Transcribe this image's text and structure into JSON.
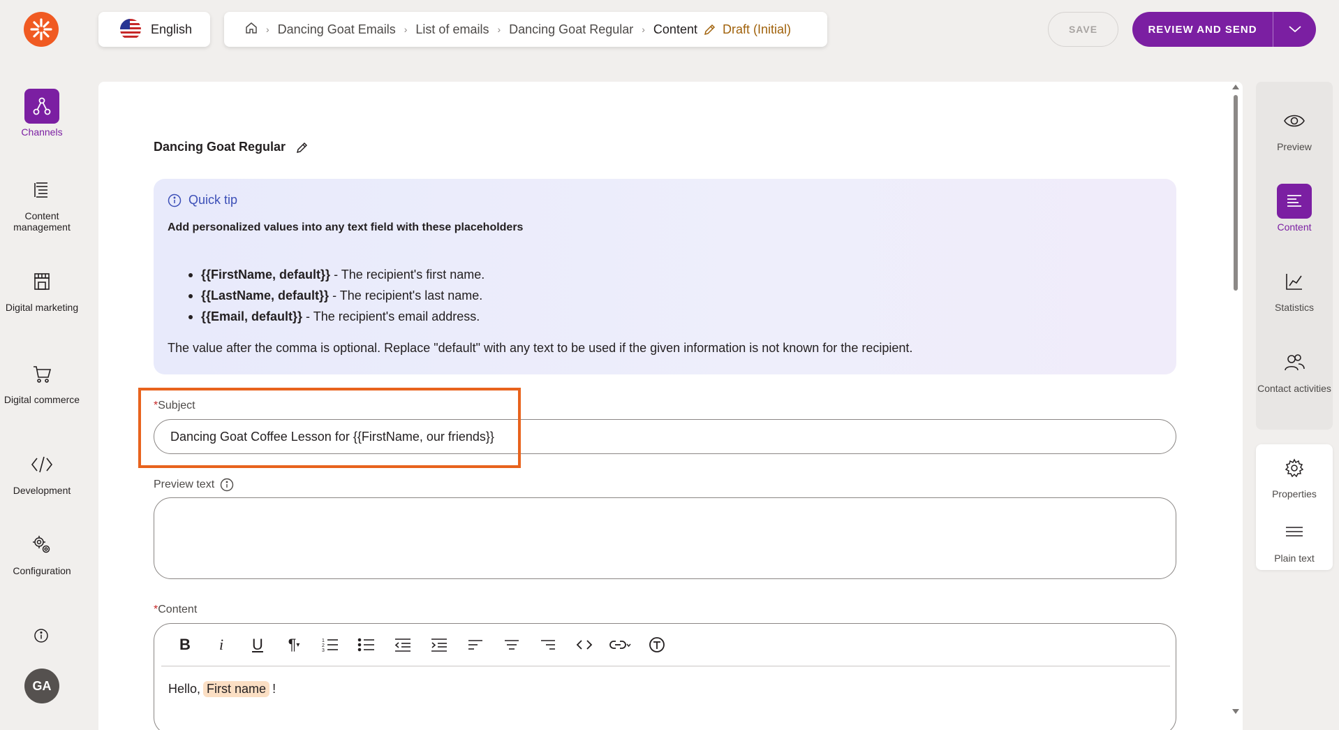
{
  "app": {
    "logo_icon": "kentico-logo-icon",
    "brand_color": "#7b1fa2",
    "accent_color": "#f05a22"
  },
  "left_nav": {
    "items": [
      {
        "label": "Channels",
        "icon": "channels-icon",
        "active": true
      },
      {
        "label": "Content management",
        "icon": "content-management-icon",
        "active": false
      },
      {
        "label": "Digital marketing",
        "icon": "digital-marketing-icon",
        "active": false
      },
      {
        "label": "Digital commerce",
        "icon": "cart-icon",
        "active": false
      },
      {
        "label": "Development",
        "icon": "code-icon",
        "active": false
      },
      {
        "label": "Configuration",
        "icon": "gears-icon",
        "active": false
      }
    ],
    "avatar_initials": "GA"
  },
  "header": {
    "language": "English",
    "breadcrumb": [
      "Dancing Goat Emails",
      "List of emails",
      "Dancing Goat Regular",
      "Content"
    ],
    "status": "Draft (Initial)",
    "save_label": "SAVE",
    "review_label": "REVIEW AND SEND"
  },
  "main": {
    "email_title": "Dancing Goat Regular",
    "tip": {
      "heading": "Quick tip",
      "intro": "Add personalized values into any text field with these placeholders",
      "items": [
        {
          "token": "{{FirstName, default}}",
          "desc": " - The recipient's first name."
        },
        {
          "token": "{{LastName, default}}",
          "desc": " - The recipient's last name."
        },
        {
          "token": "{{Email, default}}",
          "desc": " - The recipient's email address."
        }
      ],
      "note": "The value after the comma is optional. Replace \"default\" with any text to be used if the given information is not known for the recipient."
    },
    "subject": {
      "label": "Subject",
      "value": "Dancing Goat Coffee Lesson for {{FirstName, our friends}}"
    },
    "preview_text": {
      "label": "Preview text",
      "value": ""
    },
    "content": {
      "label": "Content",
      "greeting": "Hello,",
      "placeholder_chip": "First name",
      "exclamation": "!"
    }
  },
  "right_nav": {
    "items": [
      {
        "label": "Preview",
        "icon": "eye-icon",
        "active": false
      },
      {
        "label": "Content",
        "icon": "content-icon",
        "active": true
      },
      {
        "label": "Statistics",
        "icon": "chart-icon",
        "active": false
      },
      {
        "label": "Contact activities",
        "icon": "contacts-icon",
        "active": false
      }
    ],
    "secondary_items": [
      {
        "label": "Properties",
        "icon": "gear-icon"
      },
      {
        "label": "Plain text",
        "icon": "lines-icon"
      }
    ]
  }
}
